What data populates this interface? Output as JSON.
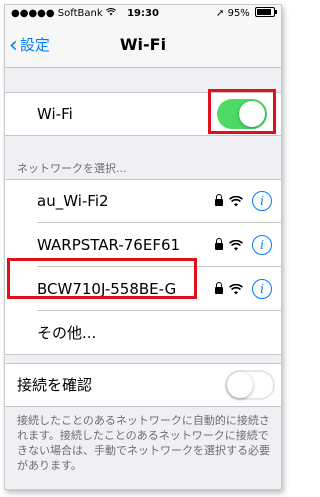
{
  "status_bar": {
    "carrier": "●●●●● SoftBank",
    "time": "19:30",
    "battery": "95%"
  },
  "nav": {
    "back_label": "設定",
    "title": "Wi-Fi"
  },
  "wifi_row": {
    "label": "Wi-Fi",
    "toggle_on": true
  },
  "networks_header": "ネットワークを選択...",
  "networks": [
    {
      "name": "au_Wi-Fi2",
      "secured": true
    },
    {
      "name": "WARPSTAR-76EF61",
      "secured": true
    },
    {
      "name": "BCW710J-558BE-G",
      "secured": true
    }
  ],
  "other_label": "その他...",
  "ask_to_join": {
    "label": "接続を確認",
    "toggle_on": false
  },
  "footer_text": "接続したことのあるネットワークに自動的に接続されます。接続したことのあるネットワークに接続できない場合は、手動でネットワークを選択する必要があります。",
  "colors": {
    "accent": "#007aff",
    "toggle_on": "#4cd964",
    "highlight": "#e0101b"
  }
}
